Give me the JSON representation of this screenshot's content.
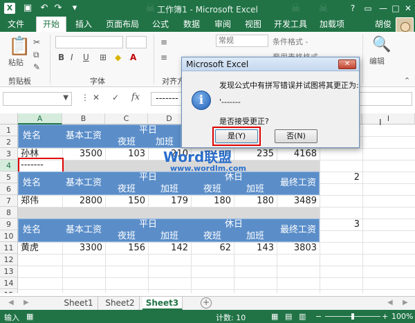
{
  "window": {
    "title": "工作簿1 - Microsoft Excel",
    "user": "胡俊"
  },
  "ribbon_tabs": [
    "文件",
    "开始",
    "插入",
    "页面布局",
    "公式",
    "数据",
    "审阅",
    "视图",
    "开发工具",
    "加载项"
  ],
  "ribbon": {
    "paste": "粘贴",
    "clipboard": "剪贴板",
    "font": "字体",
    "alignment": "对齐方",
    "number_format": "常规",
    "conditional_format": "条件格式 -",
    "table_format": "套用表格格式 -",
    "edit": "编辑"
  },
  "formula_bar": {
    "name_box": "",
    "fx": "fx",
    "value": "-------"
  },
  "columns": [
    "A",
    "B",
    "C",
    "D",
    "E",
    "F",
    "G",
    "H",
    "I"
  ],
  "rows": [
    "1",
    "2",
    "3",
    "4",
    "5",
    "6",
    "7",
    "8",
    "9",
    "10",
    "11",
    "12",
    "13",
    "14",
    "15"
  ],
  "sheet": {
    "row1_a": "姓名",
    "row1_b": "基本工资",
    "row1_c": "平日",
    "row2_c": "夜班",
    "row2_d": "加班",
    "row3": {
      "a": "孙林",
      "b": "3500",
      "c": "103",
      "d": "210",
      "f": "235",
      "g": "4168"
    },
    "row4_a": "-------",
    "row5_a": "姓名",
    "row5_b": "基本工资",
    "row5_c": "平日",
    "row5_e": "休日",
    "row5_g": "最终工资",
    "row5_h": "2",
    "row6": {
      "c": "夜班",
      "d": "加班",
      "e": "夜班",
      "f": "加班"
    },
    "row7": {
      "a": "郑伟",
      "b": "2800",
      "c": "150",
      "d": "179",
      "e": "180",
      "f": "180",
      "g": "3489"
    },
    "row9_a": "姓名",
    "row9_b": "基本工资",
    "row9_c": "平日",
    "row9_e": "休日",
    "row9_g": "最终工资",
    "row9_h": "3",
    "row10": {
      "c": "夜班",
      "d": "加班",
      "e": "夜班",
      "f": "加班"
    },
    "row11": {
      "a": "黄虎",
      "b": "3300",
      "c": "156",
      "d": "142",
      "e": "62",
      "f": "143",
      "g": "3803"
    }
  },
  "watermark": {
    "line1": "Word联盟",
    "line2": "www.wordlm.com"
  },
  "dialog": {
    "title": "Microsoft Excel",
    "message": "发现公式中有拼写错误并试图将其更正为:",
    "suggestion": "'-------",
    "question": "是否接受更正?",
    "yes": "是(Y)",
    "no": "否(N)"
  },
  "sheet_tabs": [
    "Sheet1",
    "Sheet2",
    "Sheet3"
  ],
  "status": {
    "mode": "输入",
    "count": "计数: 10",
    "zoom": "100%"
  }
}
